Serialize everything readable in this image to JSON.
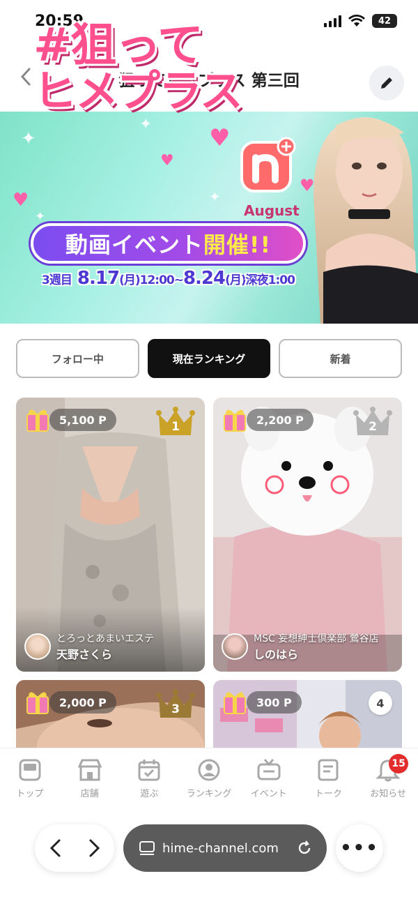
{
  "status": {
    "time": "20:59",
    "battery": "42"
  },
  "header": {
    "title": "狙ってヒメプラス 第三回"
  },
  "banner": {
    "title_line1": "#狙って",
    "title_line2": "ヒメプラス",
    "month": "August",
    "pill_text_a": "動画イベント",
    "pill_text_b": "開催!!",
    "week": "3週目",
    "date_start": "8.17",
    "day_start": "(月)",
    "time_start": "12:00~",
    "date_end": "8.24",
    "day_end": "(月)",
    "time_end": "深夜1:00"
  },
  "tabs": [
    {
      "label": "フォロー中",
      "active": false
    },
    {
      "label": "現在ランキング",
      "active": true
    },
    {
      "label": "新着",
      "active": false
    }
  ],
  "cards": [
    {
      "points": "5,100 P",
      "rank": "1",
      "shop": "とろっとあまいエステ",
      "name": "天野さくら"
    },
    {
      "points": "2,200 P",
      "rank": "2",
      "shop": "MSC 妄想紳士倶楽部 鶯谷店",
      "name": "しのはら"
    },
    {
      "points": "2,000 P",
      "rank": "3"
    },
    {
      "points": "300 P",
      "rank": "4"
    }
  ],
  "bottom_nav": [
    {
      "label": "トップ",
      "icon": "home-icon"
    },
    {
      "label": "店舗",
      "icon": "store-icon"
    },
    {
      "label": "遊ぶ",
      "icon": "calendar-icon"
    },
    {
      "label": "ランキング",
      "icon": "ranking-icon"
    },
    {
      "label": "イベント",
      "icon": "tv-icon"
    },
    {
      "label": "トーク",
      "icon": "chat-icon"
    },
    {
      "label": "お知らせ",
      "icon": "bell-icon",
      "badge": "15"
    }
  ],
  "browser": {
    "url": "hime-channel.com"
  },
  "colors": {
    "accent_pink": "#ff4f8d",
    "gold": "#c9a227",
    "silver": "#b5b5b5",
    "bronze": "#9b7a35",
    "badge_red": "#e32c2c"
  }
}
